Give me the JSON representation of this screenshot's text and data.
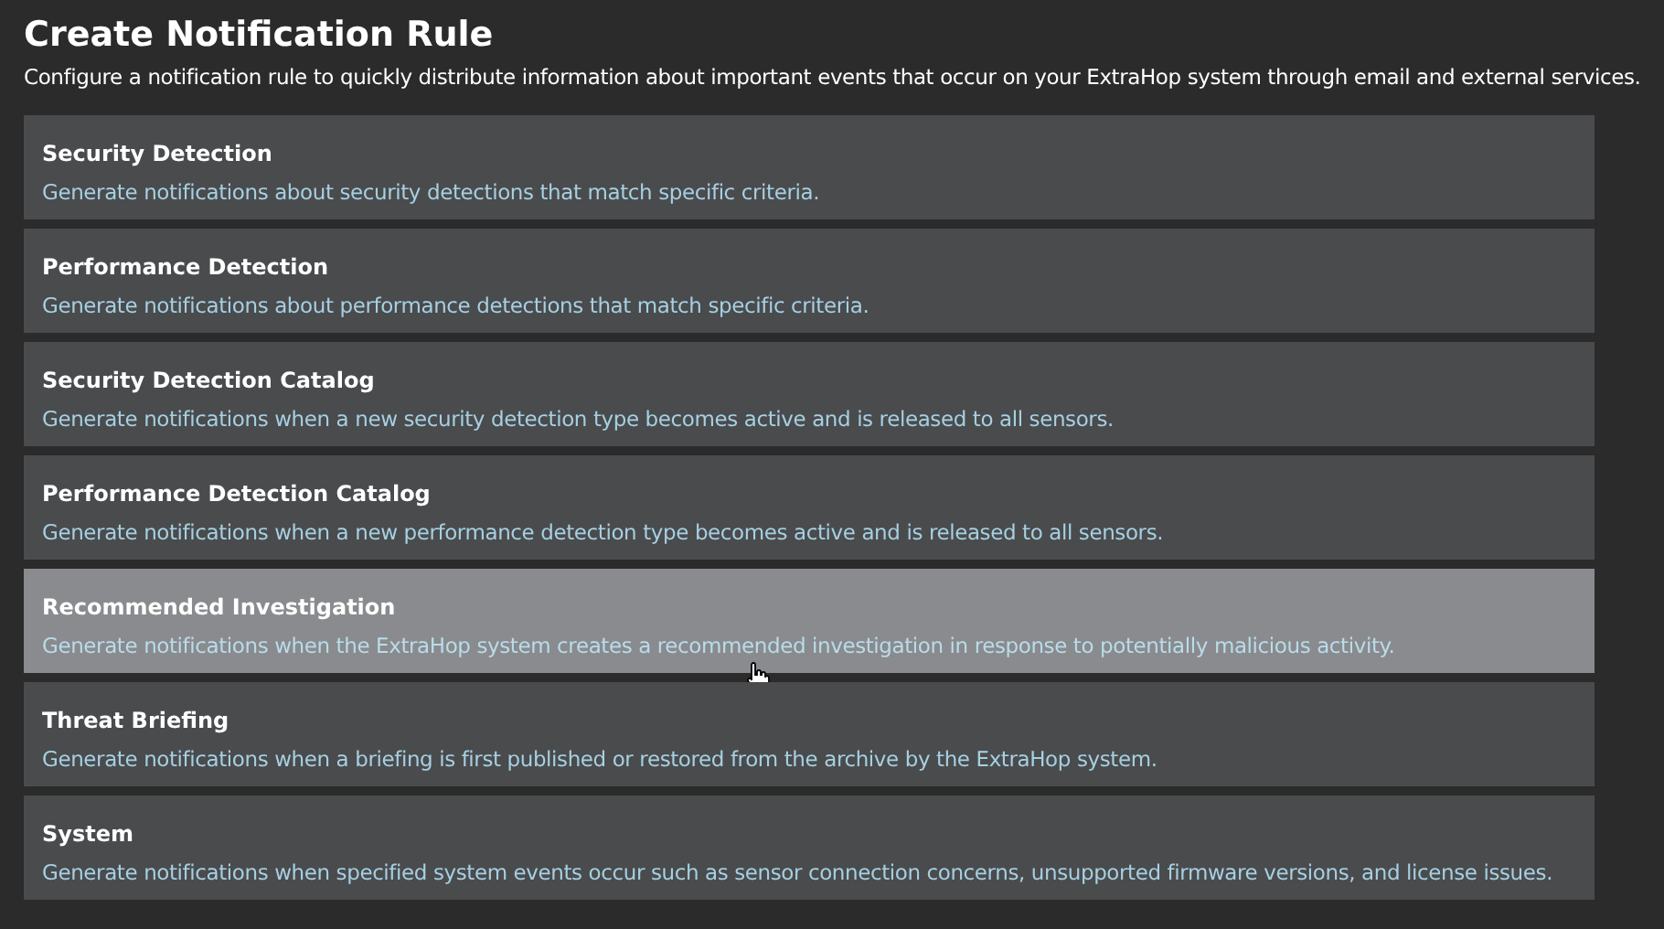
{
  "title": "Create Notification Rule",
  "subtitle": "Configure a notification rule to quickly distribute information about important events that occur on your ExtraHop system through email and external services.",
  "rules": [
    {
      "name": "Security Detection",
      "description": "Generate notifications about security detections that match specific criteria.",
      "hovered": false
    },
    {
      "name": "Performance Detection",
      "description": "Generate notifications about performance detections that match specific criteria.",
      "hovered": false
    },
    {
      "name": "Security Detection Catalog",
      "description": "Generate notifications when a new security detection type becomes active and is released to all sensors.",
      "hovered": false
    },
    {
      "name": "Performance Detection Catalog",
      "description": "Generate notifications when a new performance detection type becomes active and is released to all sensors.",
      "hovered": false
    },
    {
      "name": "Recommended Investigation",
      "description": "Generate notifications when the ExtraHop system creates a recommended investigation in response to potentially malicious activity.",
      "hovered": true
    },
    {
      "name": "Threat Briefing",
      "description": "Generate notifications when a briefing is first published or restored from the archive by the ExtraHop system.",
      "hovered": false
    },
    {
      "name": "System",
      "description": "Generate notifications when specified system events occur such as sensor connection concerns, unsupported firmware versions, and license issues.",
      "hovered": false
    }
  ]
}
